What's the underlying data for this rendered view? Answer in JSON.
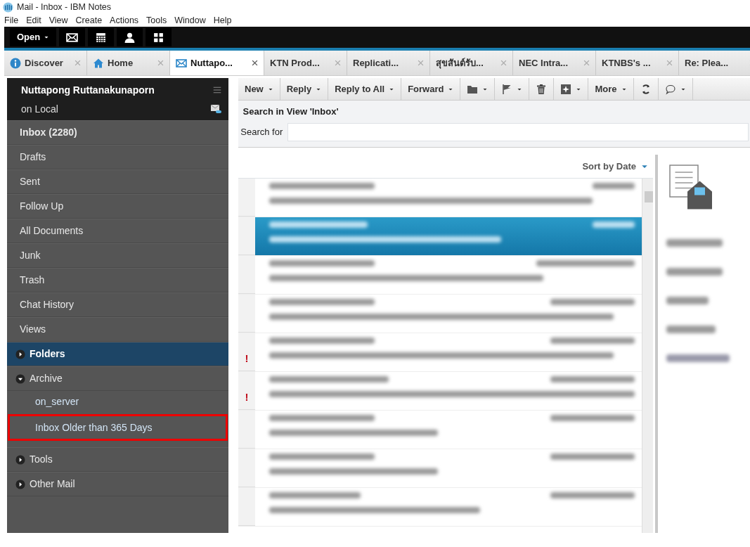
{
  "window": {
    "title": "Mail - Inbox - IBM Notes"
  },
  "menu": [
    "File",
    "Edit",
    "View",
    "Create",
    "Actions",
    "Tools",
    "Window",
    "Help"
  ],
  "launcher": {
    "open_label": "Open"
  },
  "tabs": [
    {
      "label": "Discover",
      "selected": false
    },
    {
      "label": "Home",
      "selected": false
    },
    {
      "label": "Nuttapo...",
      "selected": true
    },
    {
      "label": "KTN Prod...",
      "selected": false
    },
    {
      "label": "Replicati...",
      "selected": false
    },
    {
      "label": "สุขสันต์รับ...",
      "selected": false
    },
    {
      "label": "NEC Intra...",
      "selected": false
    },
    {
      "label": "KTNBS's ...",
      "selected": false
    },
    {
      "label": "Re: Plea...",
      "selected": false
    }
  ],
  "sidebar": {
    "owner": "Nuttapong Ruttanakunaporn",
    "location": "on Local",
    "items": [
      {
        "label": "Inbox (2280)",
        "kind": "view",
        "bold": true,
        "selected": false
      },
      {
        "label": "Drafts",
        "kind": "view",
        "selected": false
      },
      {
        "label": "Sent",
        "kind": "view",
        "selected": false
      },
      {
        "label": "Follow Up",
        "kind": "view",
        "selected": false
      },
      {
        "label": "All Documents",
        "kind": "view",
        "selected": false
      },
      {
        "label": "Junk",
        "kind": "view",
        "selected": false
      },
      {
        "label": "Trash",
        "kind": "view",
        "selected": false
      },
      {
        "label": "Chat History",
        "kind": "view",
        "selected": false
      },
      {
        "label": "Views",
        "kind": "view",
        "selected": false
      },
      {
        "label": "Folders",
        "kind": "section",
        "expanded": false,
        "selected": true
      },
      {
        "label": "Archive",
        "kind": "section",
        "expanded": true,
        "selected": false,
        "children": [
          {
            "label": "on_server",
            "highlighted": false
          },
          {
            "label": "Inbox Older than 365 Days",
            "highlighted": true
          }
        ]
      },
      {
        "label": "Tools",
        "kind": "section",
        "expanded": false,
        "selected": false
      },
      {
        "label": "Other Mail",
        "kind": "section",
        "expanded": false,
        "selected": false
      }
    ]
  },
  "actions": [
    {
      "label": "New",
      "kind": "text",
      "dropdown": true
    },
    {
      "label": "Reply",
      "kind": "text",
      "dropdown": true
    },
    {
      "label": "Reply to All",
      "kind": "text",
      "dropdown": true
    },
    {
      "label": "Forward",
      "kind": "text",
      "dropdown": true
    },
    {
      "kind": "icon",
      "dropdown": true
    },
    {
      "kind": "icon",
      "dropdown": true
    },
    {
      "kind": "icon",
      "dropdown": false
    },
    {
      "kind": "icon",
      "dropdown": true
    },
    {
      "label": "More",
      "kind": "text",
      "dropdown": true
    },
    {
      "kind": "icon",
      "dropdown": false
    },
    {
      "kind": "icon",
      "dropdown": true
    }
  ],
  "search": {
    "title": "Search in View 'Inbox'",
    "label": "Search for"
  },
  "list": {
    "sort_label": "Sort by Date",
    "rows": [
      {
        "selected": false
      },
      {
        "selected": true
      },
      {
        "selected": false
      },
      {
        "selected": false
      },
      {
        "selected": false,
        "flag": "!"
      },
      {
        "selected": false,
        "flag": "!"
      },
      {
        "selected": false
      },
      {
        "selected": false
      },
      {
        "selected": false
      }
    ]
  }
}
